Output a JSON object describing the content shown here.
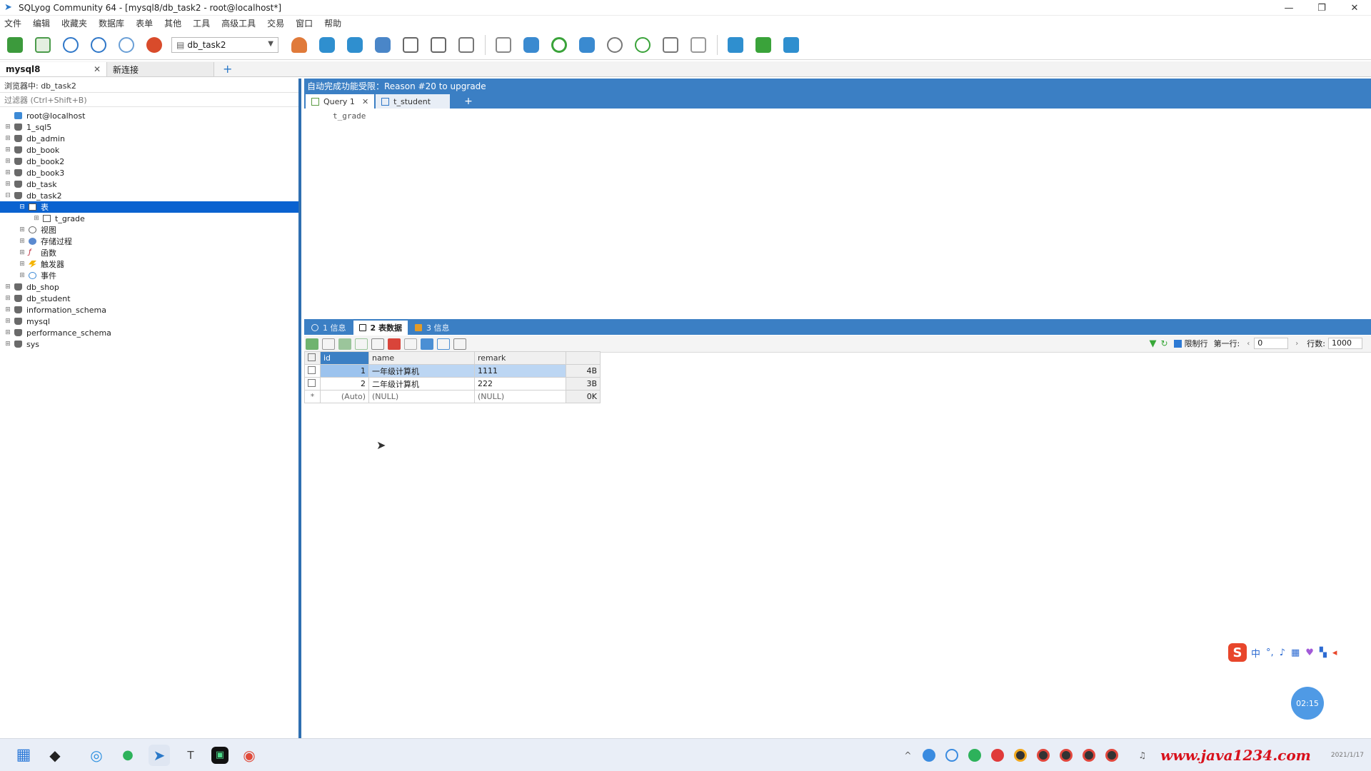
{
  "window": {
    "title": "SQLyog Community 64 - [mysql8/db_task2 - root@localhost*]"
  },
  "menu": [
    "文件",
    "编辑",
    "收藏夹",
    "数据库",
    "表单",
    "其他",
    "工具",
    "高级工具",
    "交易",
    "窗口",
    "帮助"
  ],
  "toolbar": {
    "db_selector": "db_task2"
  },
  "connection_tabs": [
    {
      "label": "mysql8",
      "active": true
    },
    {
      "label": "新连接",
      "active": false
    }
  ],
  "left_panel": {
    "info": "浏览器中: db_task2",
    "filter_placeholder": "过滤器 (Ctrl+Shift+B)",
    "tree": [
      {
        "label": "root@localhost",
        "depth": 0,
        "icon": "root"
      },
      {
        "label": "1_sql5",
        "depth": 0,
        "icon": "db"
      },
      {
        "label": "db_admin",
        "depth": 0,
        "icon": "db"
      },
      {
        "label": "db_book",
        "depth": 0,
        "icon": "db"
      },
      {
        "label": "db_book2",
        "depth": 0,
        "icon": "db"
      },
      {
        "label": "db_book3",
        "depth": 0,
        "icon": "db"
      },
      {
        "label": "db_task",
        "depth": 0,
        "icon": "db"
      },
      {
        "label": "db_task2",
        "depth": 0,
        "icon": "db",
        "expanded": true
      },
      {
        "label": "表",
        "depth": 1,
        "icon": "tbl",
        "selected": true,
        "expanded": true
      },
      {
        "label": "t_grade",
        "depth": 2,
        "icon": "tbl"
      },
      {
        "label": "视图",
        "depth": 1,
        "icon": "view"
      },
      {
        "label": "存储过程",
        "depth": 1,
        "icon": "proc"
      },
      {
        "label": "函数",
        "depth": 1,
        "icon": "func"
      },
      {
        "label": "触发器",
        "depth": 1,
        "icon": "trig"
      },
      {
        "label": "事件",
        "depth": 1,
        "icon": "event"
      },
      {
        "label": "db_shop",
        "depth": 0,
        "icon": "db"
      },
      {
        "label": "db_student",
        "depth": 0,
        "icon": "db"
      },
      {
        "label": "information_schema",
        "depth": 0,
        "icon": "db"
      },
      {
        "label": "mysql",
        "depth": 0,
        "icon": "db"
      },
      {
        "label": "performance_schema",
        "depth": 0,
        "icon": "db"
      },
      {
        "label": "sys",
        "depth": 0,
        "icon": "db"
      }
    ]
  },
  "editor": {
    "notice": "自动完成功能受限：Reason #20 to upgrade",
    "tabs": [
      {
        "label": "Query 1",
        "active": true,
        "closable": true
      },
      {
        "label": "t_student",
        "active": false,
        "closable": false
      }
    ],
    "code_line": "t_grade"
  },
  "results": {
    "tabs": [
      {
        "label": "1 信息",
        "active": false
      },
      {
        "label": "2 表数据",
        "active": true
      },
      {
        "label": "3 信息",
        "active": false
      }
    ],
    "limit_label": "限制行",
    "first_row_label": "第一行:",
    "first_row_value": "0",
    "rows_label": "行数:",
    "rows_value": "1000",
    "columns": [
      "id",
      "name",
      "remark"
    ],
    "rows": [
      {
        "id": "1",
        "name": "一年级计算机",
        "remark": "1111",
        "size": "4B"
      },
      {
        "id": "2",
        "name": "二年级计算机",
        "remark": "222",
        "size": "3B"
      },
      {
        "id": "(Auto)",
        "name": "(NULL)",
        "remark": "(NULL)",
        "size": "0K"
      }
    ]
  },
  "ime": {
    "logo": "S",
    "mode": "中"
  },
  "timer": "02:15",
  "taskbar": {
    "watermark": "www.java1234.com",
    "clock": "2021/1/17"
  }
}
